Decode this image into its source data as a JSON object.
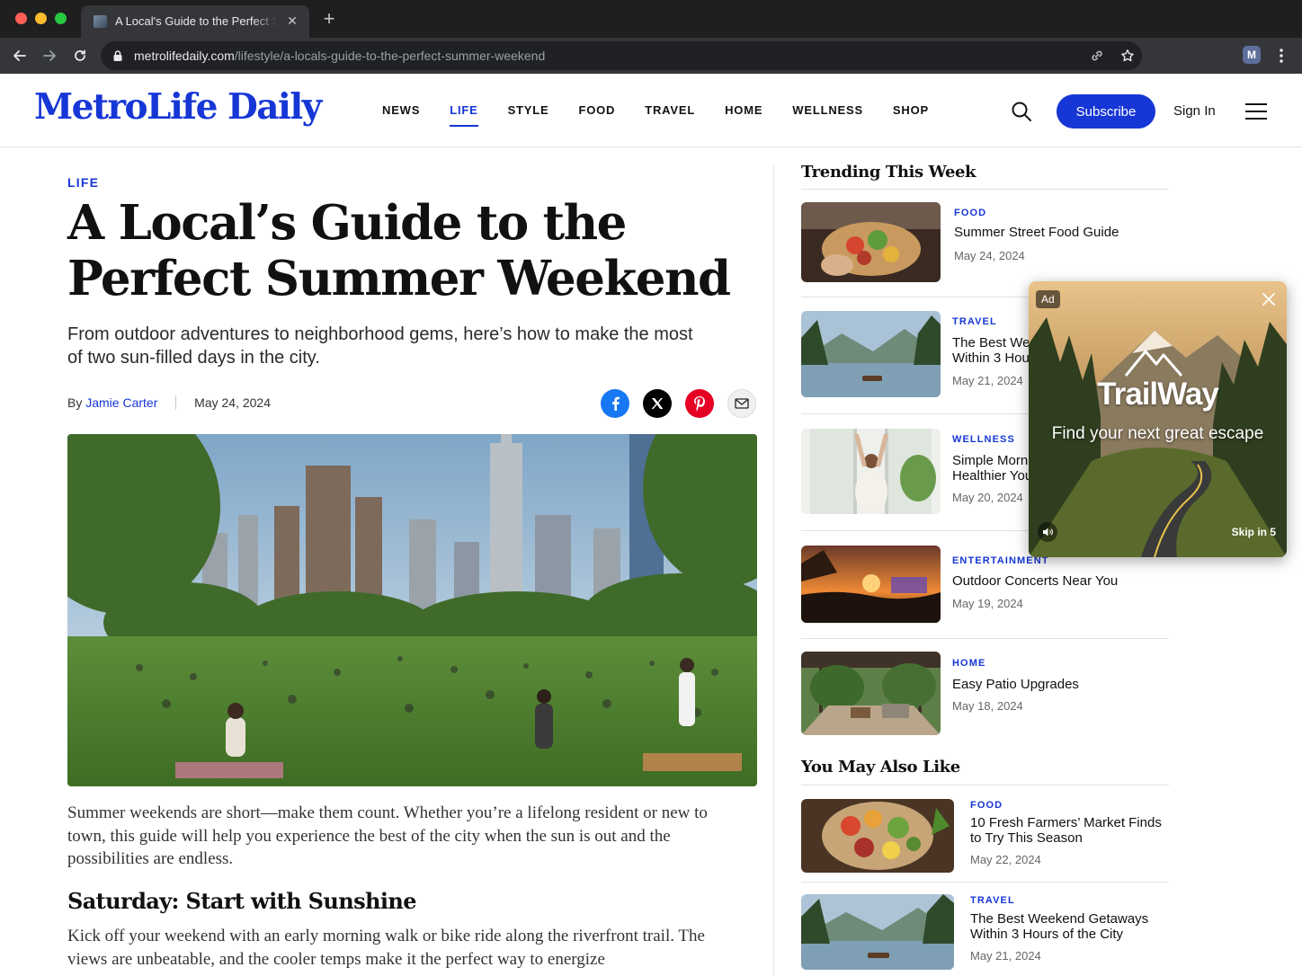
{
  "browser": {
    "tab_title": "A Local's Guide to the Perfect Summer Weekend",
    "url_domain": "metrolifedaily.com",
    "url_path": "/lifestyle/a-locals-guide-to-the-perfect-summer-weekend",
    "profile_initial": "M"
  },
  "site": {
    "logo": "MetroLife Daily",
    "nav": [
      "NEWS",
      "LIFE",
      "STYLE",
      "FOOD",
      "TRAVEL",
      "HOME",
      "WELLNESS",
      "SHOP"
    ],
    "active_nav": "LIFE",
    "subscribe_label": "Subscribe",
    "signin_label": "Sign In"
  },
  "article": {
    "category": "LIFE",
    "headline": "A Local’s Guide to the Perfect Summer Weekend",
    "dek": "From outdoor adventures to neighborhood gems, here’s how to make the most of two sun-filled days in the city.",
    "byline_prefix": "By",
    "author": "Jamie Carter",
    "date": "May 24, 2024",
    "paragraph_1": "Summer weekends are short—make them count. Whether you’re a lifelong resident or new to town, this guide will help you experience the best of the city when the sun is out and the possibilities are endless.",
    "subhead_1": "Saturday: Start with Sunshine",
    "paragraph_2": "Kick off your weekend with an early morning walk or bike ride along the riverfront trail. The views are unbeatable, and the cooler temps make it the perfect way to energize"
  },
  "trending": {
    "title": "Trending This Week",
    "items": [
      {
        "category": "FOOD",
        "title": "Summer Street Food Guide",
        "date": "May 24, 2024"
      },
      {
        "category": "TRAVEL",
        "title": "The Best Weekend Getaways Within 3 Hours of the City",
        "date": "May 21, 2024"
      },
      {
        "category": "WELLNESS",
        "title": "Simple Morning Habits for a Healthier You",
        "date": "May 20, 2024"
      },
      {
        "category": "ENTERTAINMENT",
        "title": "Outdoor Concerts Near You",
        "date": "May 19, 2024"
      },
      {
        "category": "HOME",
        "title": "Easy Patio Upgrades",
        "date": "May 18, 2024"
      }
    ]
  },
  "also_like": {
    "title": "You May Also Like",
    "items": [
      {
        "category": "FOOD",
        "title": "10 Fresh Farmers’ Market Finds to Try This Season",
        "date": "May 22, 2024"
      },
      {
        "category": "TRAVEL",
        "title": "The Best Weekend Getaways Within 3 Hours of the City",
        "date": "May 21, 2024"
      }
    ]
  },
  "ad": {
    "badge": "Ad",
    "brand": "TrailWay",
    "tagline": "Find your next great escape",
    "skip": "Skip in 5"
  },
  "colors": {
    "brand_blue": "#1636d6",
    "facebook": "#1877f2",
    "pinterest": "#e60023"
  }
}
